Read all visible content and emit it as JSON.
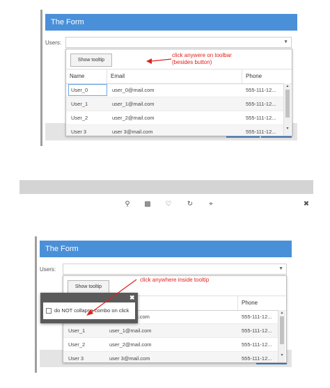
{
  "top": {
    "form_title": "The Form",
    "users_label": "Users:",
    "toolbar_button": "Show tooltip",
    "annotation_line1": "click anywere on toolbar",
    "annotation_line2": "(besides button)",
    "columns": [
      "Name",
      "Email",
      "Phone"
    ],
    "rows": [
      {
        "name": "User_0",
        "email": "user_0@mail.com",
        "phone": "555-111-12..."
      },
      {
        "name": "User_1",
        "email": "user_1@mail.com",
        "phone": "555-111-12..."
      },
      {
        "name": "User_2",
        "email": "user_2@mail.com",
        "phone": "555-111-12..."
      },
      {
        "name": "User 3",
        "email": "user 3@mail.com",
        "phone": "555-111-12..."
      }
    ]
  },
  "middle": {
    "icons": [
      "zoom-in-icon",
      "trash-icon",
      "heart-icon",
      "rotate-icon",
      "crop-icon",
      "tools-icon"
    ]
  },
  "bottom": {
    "form_title": "The Form",
    "users_label": "Users:",
    "toolbar_button": "Show tooltip",
    "annotation": "click anywhere inside tooltip",
    "tooltip_close": "✖",
    "checkbox_label": "do NOT collapse combo on click",
    "columns": [
      "Phone"
    ],
    "rows": [
      {
        "name": "",
        "email": "l.com",
        "phone": "555-111-12..."
      },
      {
        "name": "User_1",
        "email": "user_1@mail.com",
        "phone": "555-111-12..."
      },
      {
        "name": "User_2",
        "email": "user_2@mail.com",
        "phone": "555-111-12..."
      },
      {
        "name": "User 3",
        "email": "user 3@mail.com",
        "phone": "555-111-12..."
      }
    ]
  },
  "colors": {
    "header_blue": "#4a90d9",
    "annotation_red": "#e0211c",
    "tooltip_gray": "#5a5a5a"
  }
}
